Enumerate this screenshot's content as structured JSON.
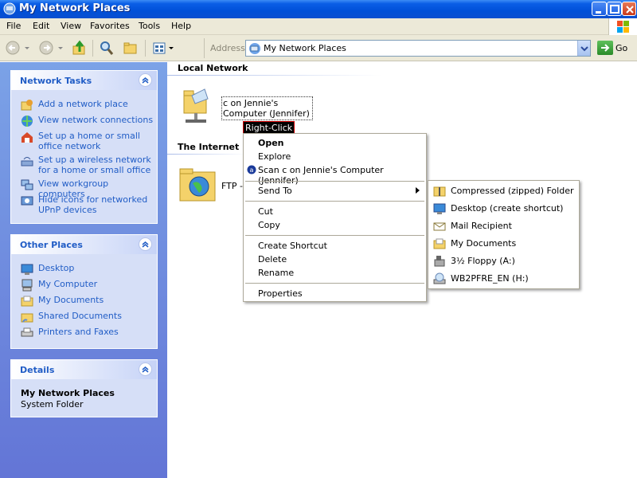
{
  "window": {
    "title": "My Network Places"
  },
  "menubar": {
    "items": [
      "File",
      "Edit",
      "View",
      "Favorites",
      "Tools",
      "Help"
    ]
  },
  "toolbar": {
    "address_label": "Address",
    "address_value": "My Network Places",
    "go_label": "Go"
  },
  "sidebar": {
    "network_tasks": {
      "title": "Network Tasks",
      "items": [
        {
          "label": "Add a network place",
          "icon": "add-network-place-icon"
        },
        {
          "label": "View network connections",
          "icon": "network-connections-icon"
        },
        {
          "label": "Set up a home or small office network",
          "icon": "home-network-icon"
        },
        {
          "label": "Set up a wireless network for a home or small office",
          "icon": "wireless-network-icon"
        },
        {
          "label": "View workgroup computers",
          "icon": "workgroup-icon"
        },
        {
          "label": "Hide icons for networked UPnP devices",
          "icon": "upnp-icon"
        }
      ]
    },
    "other_places": {
      "title": "Other Places",
      "items": [
        {
          "label": "Desktop",
          "icon": "desktop-icon"
        },
        {
          "label": "My Computer",
          "icon": "my-computer-icon"
        },
        {
          "label": "My Documents",
          "icon": "my-documents-icon"
        },
        {
          "label": "Shared Documents",
          "icon": "shared-documents-icon"
        },
        {
          "label": "Printers and Faxes",
          "icon": "printers-icon"
        }
      ]
    },
    "details": {
      "title": "Details",
      "name": "My Network Places",
      "type": "System Folder"
    }
  },
  "content": {
    "local_network": {
      "header": "Local Network",
      "item_label": "c on Jennie's Computer (Jennifer)"
    },
    "internet": {
      "header": "The Internet",
      "item_label": "FTP --"
    },
    "annotation": "Right-Click"
  },
  "context_menu": {
    "items": [
      "Open",
      "Explore",
      "Scan c on Jennie's Computer (Jennifer)",
      "Send To",
      "Cut",
      "Copy",
      "Create Shortcut",
      "Delete",
      "Rename",
      "Properties"
    ]
  },
  "send_to_menu": {
    "items": [
      {
        "label": "Compressed (zipped) Folder",
        "icon": "zip-folder-icon"
      },
      {
        "label": "Desktop (create shortcut)",
        "icon": "desktop-icon"
      },
      {
        "label": "Mail Recipient",
        "icon": "mail-icon"
      },
      {
        "label": "My Documents",
        "icon": "my-documents-icon"
      },
      {
        "label": "3½ Floppy (A:)",
        "icon": "floppy-icon"
      },
      {
        "label": "WB2PFRE_EN (H:)",
        "icon": "cd-drive-icon"
      }
    ]
  }
}
